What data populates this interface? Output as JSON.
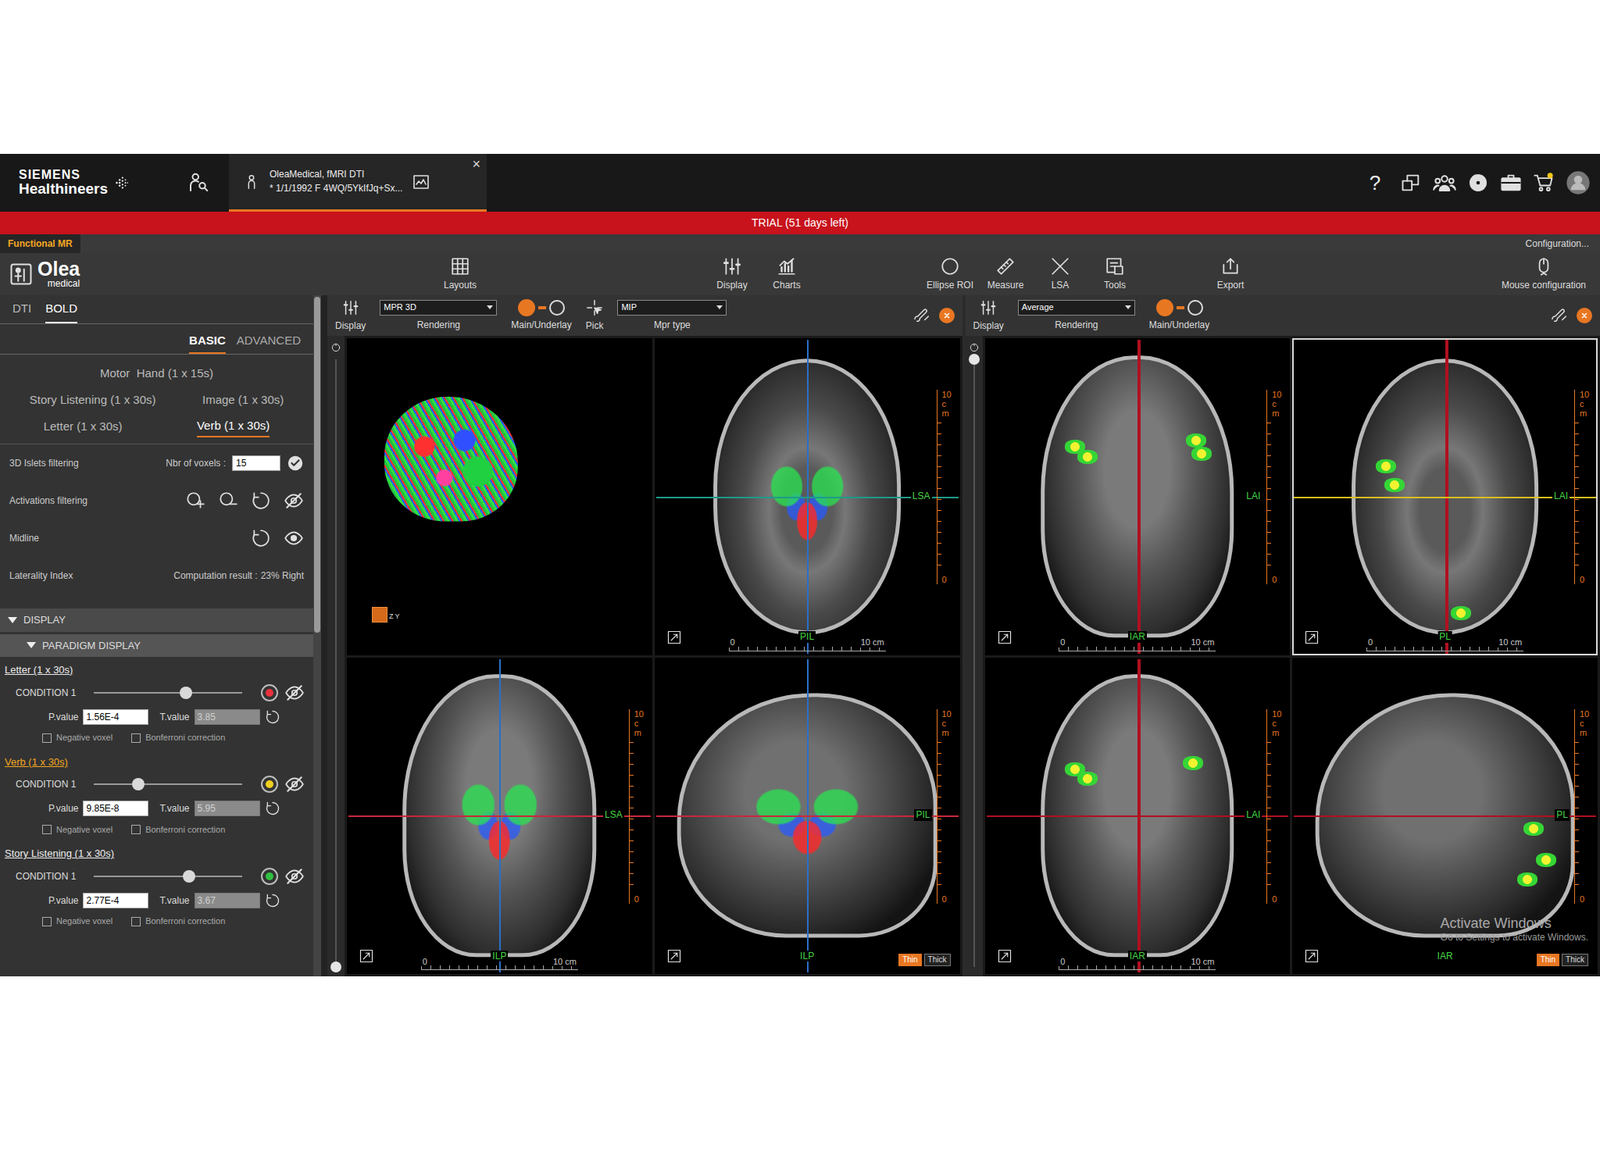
{
  "header": {
    "brand": "SIEMENS",
    "brand_sub": "Healthineers",
    "patient_tab": {
      "title": "OleaMedical, fMRI DTI",
      "subtitle": "* 1/1/1992 F 4WQ/5YkIfJq+Sx...",
      "close": "×",
      "selected": true
    },
    "help": "?"
  },
  "trial_banner": "TRIAL (51 days left)",
  "module_bar": {
    "module": "Functional MR",
    "configuration": "Configuration..."
  },
  "toolbar": {
    "logo": "Olea",
    "logo_sub": "medical",
    "items": [
      {
        "label": "Layouts"
      },
      {
        "label": "Display"
      },
      {
        "label": "Charts"
      },
      {
        "label": "Ellipse ROI"
      },
      {
        "label": "Measure"
      },
      {
        "label": "LSA"
      },
      {
        "label": "Tools"
      },
      {
        "label": "Export"
      },
      {
        "label": "Mouse configuration"
      }
    ]
  },
  "left_panel": {
    "tabs": [
      {
        "label": "DTI",
        "selected": false
      },
      {
        "label": "BOLD",
        "selected": true
      }
    ],
    "modes": [
      {
        "label": "BASIC",
        "selected": true
      },
      {
        "label": "ADVANCED",
        "selected": false
      }
    ],
    "paradigms": [
      [
        {
          "label": "Motor  Hand (1 x 15s)",
          "selected": false
        }
      ],
      [
        {
          "label": "Story Listening (1 x 30s)",
          "selected": false
        },
        {
          "label": "Image (1 x 30s)",
          "selected": false
        }
      ],
      [
        {
          "label": "Letter (1 x 30s)",
          "selected": false
        },
        {
          "label": "Verb (1 x 30s)",
          "selected": true
        }
      ]
    ],
    "islets": {
      "label": "3D Islets filtering",
      "field_label": "Nbr of voxels :",
      "value": "15"
    },
    "activations": {
      "label": "Activations filtering",
      "visible": false
    },
    "midline": {
      "label": "Midline",
      "visible": true
    },
    "laterality": {
      "label": "Laterality Index",
      "result_label": "Computation result :",
      "result": "23% Right"
    },
    "display": {
      "label": "DISPLAY",
      "expanded": true,
      "sub": {
        "label": "PARADIGM DISPLAY",
        "expanded": true
      }
    },
    "conditions": [
      {
        "paradigm": "Letter (1 x 30s)",
        "selected": false,
        "condition": "CONDITION 1",
        "level": 0.62,
        "color": "#e8323c",
        "p_label": "P.value",
        "p_value": "1.56E-4",
        "t_label": "T.value",
        "t_value": "3.85",
        "t_disabled": true,
        "negative": {
          "label": "Negative voxel",
          "checked": false
        },
        "bonferroni": {
          "label": "Bonferroni correction",
          "checked": false
        }
      },
      {
        "paradigm": "Verb (1 x 30s)",
        "selected": true,
        "condition": "CONDITION 1",
        "level": 0.3,
        "color": "#f0d020",
        "p_label": "P.value",
        "p_value": "9.85E-8",
        "t_label": "T.value",
        "t_value": "5.95",
        "t_disabled": true,
        "negative": {
          "label": "Negative voxel",
          "checked": false
        },
        "bonferroni": {
          "label": "Bonferroni correction",
          "checked": false
        }
      },
      {
        "paradigm": "Story Listening (1 x 30s)",
        "selected": false,
        "condition": "CONDITION 1",
        "level": 0.64,
        "color": "#30c040",
        "p_label": "P.value",
        "p_value": "2.77E-4",
        "t_label": "T.value",
        "t_value": "3.67",
        "t_disabled": true,
        "negative": {
          "label": "Negative voxel",
          "checked": false
        },
        "bonferroni": {
          "label": "Bonferroni correction",
          "checked": false
        }
      }
    ]
  },
  "viewers": [
    {
      "overlay": "tracts",
      "display": "Display",
      "rendering_label": "Rendering",
      "rendering": "MPR 3D",
      "toggle": {
        "label": "Main/Underlay",
        "on": true
      },
      "pick": "Pick",
      "mpr_label": "Mpr type",
      "mpr": "MIP",
      "slider": {
        "level": 1
      },
      "viewports": [
        {
          "kind": "3d",
          "selected": false,
          "axes": [
            "Z",
            "Y"
          ]
        },
        {
          "kind": "axial",
          "selected": false,
          "right_label": "LSA",
          "bottom_label": "PIL",
          "ruler_right": "10 cm",
          "zero_right": "0",
          "ruler_bottom": "10 cm",
          "zero_bottom": "0"
        },
        {
          "kind": "coronal",
          "selected": false,
          "right_label": "LSA",
          "bottom_label": "ILP",
          "ruler_right": "10 cm",
          "zero_right": "0",
          "ruler_bottom": "10 cm",
          "zero_bottom": "0"
        },
        {
          "kind": "sagittal",
          "selected": false,
          "right_label": "PIL",
          "bottom_label": "ILP",
          "ruler_right": "10 cm",
          "zero_right": "0",
          "thickness": [
            {
              "label": "Thin",
              "selected": true
            },
            {
              "label": "Thick",
              "selected": false
            }
          ]
        }
      ]
    },
    {
      "overlay": "activations",
      "display": "Display",
      "rendering_label": "Rendering",
      "rendering": "Average",
      "toggle": {
        "label": "Main/Underlay",
        "on": true
      },
      "slider": {
        "level": 0
      },
      "viewports": [
        {
          "kind": "coronal",
          "selected": false,
          "right_label": "LAI",
          "bottom_label": "IAR",
          "ruler_right": "10 cm",
          "zero_right": "0",
          "ruler_bottom": "10 cm",
          "zero_bottom": "0"
        },
        {
          "kind": "axial",
          "selected": true,
          "right_label": "LAI",
          "bottom_label": "PL",
          "ruler_right": "10 cm",
          "zero_right": "0",
          "ruler_bottom": "10 cm",
          "zero_bottom": "0"
        },
        {
          "kind": "coronal",
          "selected": false,
          "right_label": "LAI",
          "bottom_label": "IAR",
          "ruler_right": "10 cm",
          "zero_right": "0",
          "ruler_bottom": "10 cm",
          "zero_bottom": "0"
        },
        {
          "kind": "sagittal",
          "selected": false,
          "right_label": "PL",
          "bottom_label": "IAR",
          "ruler_right": "10 cm",
          "zero_right": "0",
          "thickness": [
            {
              "label": "Thin",
              "selected": true
            },
            {
              "label": "Thick",
              "selected": false
            }
          ]
        }
      ]
    }
  ],
  "watermark": {
    "title": "Activate Windows",
    "subtitle": "Go to Settings to activate Windows."
  }
}
